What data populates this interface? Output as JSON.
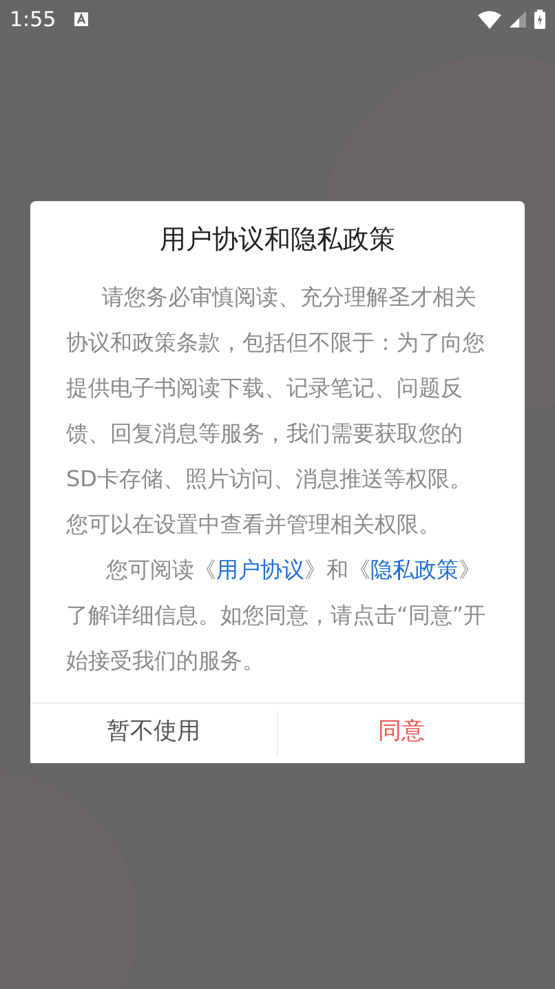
{
  "status_bar": {
    "time": "1:55"
  },
  "dialog": {
    "title": "用户协议和隐私政策",
    "paragraphs": [
      {
        "parts": [
          {
            "kind": "text",
            "text": "请您务必审慎阅读、充分理解圣才相关协议和政策条款，包括但不限于：为了向您提供电子书阅读下载、记录笔记、问题反馈、回复消息等服务，我们需要获取您的SD卡存储、照片访问、消息推送等权限。您可以在设置中查看并管理相关权限。"
          }
        ]
      },
      {
        "parts": [
          {
            "kind": "text",
            "text": "您可阅读《"
          },
          {
            "kind": "link",
            "text": "用户协议"
          },
          {
            "kind": "text",
            "text": "》和《"
          },
          {
            "kind": "link",
            "text": "隐私政策"
          },
          {
            "kind": "text",
            "text": "》了解详细信息。如您同意，请点击“同意”开始接受我们的服务。"
          }
        ]
      }
    ],
    "buttons": [
      {
        "label": "暂不使用",
        "kind": "secondary"
      },
      {
        "label": "同意",
        "kind": "primary"
      }
    ]
  }
}
